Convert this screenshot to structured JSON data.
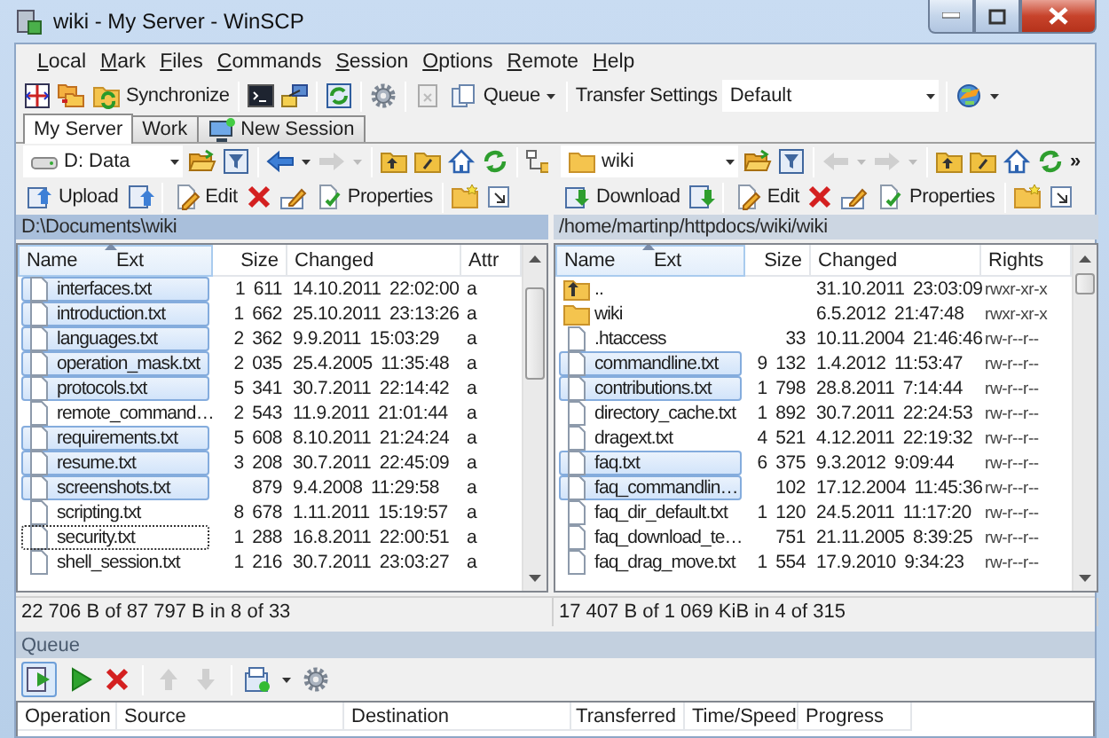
{
  "window": {
    "title": "wiki - My Server - WinSCP"
  },
  "menu": [
    "Local",
    "Mark",
    "Files",
    "Commands",
    "Session",
    "Options",
    "Remote",
    "Help"
  ],
  "toolbar": {
    "synchronize": "Synchronize",
    "queue": "Queue",
    "transfer_label": "Transfer Settings",
    "transfer_value": "Default"
  },
  "session_tabs": [
    {
      "label": "My Server",
      "selected": true,
      "kind": "session"
    },
    {
      "label": "Work",
      "selected": false,
      "kind": "session"
    },
    {
      "label": "New Session",
      "selected": false,
      "kind": "new"
    }
  ],
  "left_panel": {
    "location": "D: Data",
    "transfer_button": "Upload",
    "edit": "Edit",
    "properties": "Properties",
    "path": "D:\\Documents\\wiki",
    "active": true,
    "columns": [
      "Name",
      "Ext",
      "Size",
      "Changed",
      "Attr"
    ],
    "rows": [
      {
        "name": "interfaces.txt",
        "kind": "file",
        "size": "1 611",
        "changed": "14.10.2011 22:02:00",
        "attr": "a",
        "selected": true,
        "focused": false
      },
      {
        "name": "introduction.txt",
        "kind": "file",
        "size": "1 662",
        "changed": "25.10.2011 23:13:26",
        "attr": "a",
        "selected": true,
        "focused": false
      },
      {
        "name": "languages.txt",
        "kind": "file",
        "size": "2 362",
        "changed": "9.9.2011 15:03:29",
        "attr": "a",
        "selected": true,
        "focused": false
      },
      {
        "name": "operation_mask.txt",
        "kind": "file",
        "size": "2 035",
        "changed": "25.4.2005 11:35:48",
        "attr": "a",
        "selected": true,
        "focused": false
      },
      {
        "name": "protocols.txt",
        "kind": "file",
        "size": "5 341",
        "changed": "30.7.2011 22:14:42",
        "attr": "a",
        "selected": true,
        "focused": false
      },
      {
        "name": "remote_command…",
        "kind": "file",
        "size": "2 543",
        "changed": "11.9.2011 21:01:44",
        "attr": "a",
        "selected": false,
        "focused": false
      },
      {
        "name": "requirements.txt",
        "kind": "file",
        "size": "5 608",
        "changed": "8.10.2011 21:24:24",
        "attr": "a",
        "selected": true,
        "focused": false
      },
      {
        "name": "resume.txt",
        "kind": "file",
        "size": "3 208",
        "changed": "30.7.2011 22:45:09",
        "attr": "a",
        "selected": true,
        "focused": false
      },
      {
        "name": "screenshots.txt",
        "kind": "file",
        "size": "879",
        "changed": "9.4.2008 11:29:58",
        "attr": "a",
        "selected": true,
        "focused": false
      },
      {
        "name": "scripting.txt",
        "kind": "file",
        "size": "8 678",
        "changed": "1.11.2011 15:19:57",
        "attr": "a",
        "selected": false,
        "focused": false
      },
      {
        "name": "security.txt",
        "kind": "file",
        "size": "1 288",
        "changed": "16.8.2011 22:00:51",
        "attr": "a",
        "selected": false,
        "focused": true
      },
      {
        "name": "shell_session.txt",
        "kind": "file",
        "size": "1 216",
        "changed": "30.7.2011 23:03:27",
        "attr": "a",
        "selected": false,
        "focused": false
      }
    ],
    "status": "22 706 B of 87 797 B in 8 of 33"
  },
  "right_panel": {
    "location": "wiki",
    "transfer_button": "Download",
    "edit": "Edit",
    "properties": "Properties",
    "more": "»",
    "path": "/home/martinp/httpdocs/wiki/wiki",
    "active": false,
    "columns": [
      "Name",
      "Ext",
      "Size",
      "Changed",
      "Rights"
    ],
    "rows": [
      {
        "name": "..",
        "kind": "parent",
        "changed": "31.10.2011 23:03:09",
        "attr": "rwxr-xr-x",
        "selected": false,
        "focused": false
      },
      {
        "name": "wiki",
        "kind": "folder",
        "changed": "6.5.2012 21:47:48",
        "attr": "rwxr-xr-x",
        "selected": false,
        "focused": false
      },
      {
        "name": ".htaccess",
        "kind": "file",
        "size": "33",
        "changed": "10.11.2004 21:46:46",
        "attr": "rw-r--r--",
        "selected": false,
        "focused": false
      },
      {
        "name": "commandline.txt",
        "kind": "file",
        "size": "9 132",
        "changed": "1.4.2012 11:53:47",
        "attr": "rw-r--r--",
        "selected": true,
        "focused": false
      },
      {
        "name": "contributions.txt",
        "kind": "file",
        "size": "1 798",
        "changed": "28.8.2011 7:14:44",
        "attr": "rw-r--r--",
        "selected": true,
        "focused": false
      },
      {
        "name": "directory_cache.txt",
        "kind": "file",
        "size": "1 892",
        "changed": "30.7.2011 22:24:53",
        "attr": "rw-r--r--",
        "selected": false,
        "focused": false
      },
      {
        "name": "dragext.txt",
        "kind": "file",
        "size": "4 521",
        "changed": "4.12.2011 22:19:32",
        "attr": "rw-r--r--",
        "selected": false,
        "focused": false
      },
      {
        "name": "faq.txt",
        "kind": "file",
        "size": "6 375",
        "changed": "9.3.2012 9:09:44",
        "attr": "rw-r--r--",
        "selected": true,
        "focused": false
      },
      {
        "name": "faq_commandlin…",
        "kind": "file",
        "size": "102",
        "changed": "17.12.2004 11:45:36",
        "attr": "rw-r--r--",
        "selected": true,
        "focused": false
      },
      {
        "name": "faq_dir_default.txt",
        "kind": "file",
        "size": "1 120",
        "changed": "24.5.2011 11:17:20",
        "attr": "rw-r--r--",
        "selected": false,
        "focused": false
      },
      {
        "name": "faq_download_te…",
        "kind": "file",
        "size": "751",
        "changed": "21.11.2005 8:39:25",
        "attr": "rw-r--r--",
        "selected": false,
        "focused": false
      },
      {
        "name": "faq_drag_move.txt",
        "kind": "file",
        "size": "1 554",
        "changed": "17.9.2010 9:34:23",
        "attr": "rw-r--r--",
        "selected": false,
        "focused": false
      }
    ],
    "status": "17 407 B of 1 069 KiB in 4 of 315"
  },
  "queue": {
    "title": "Queue",
    "columns": [
      "Operation",
      "Source",
      "Destination",
      "Transferred",
      "Time/Speed",
      "Progress"
    ]
  }
}
